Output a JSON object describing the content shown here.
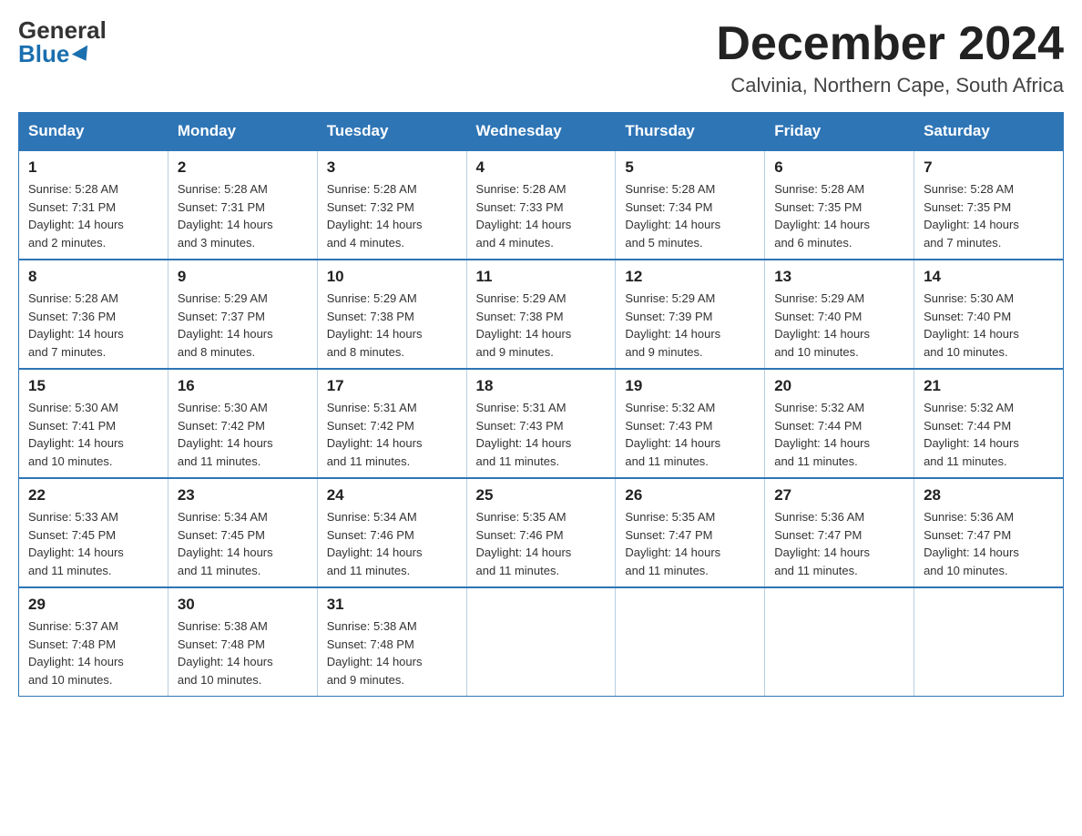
{
  "header": {
    "logo_general": "General",
    "logo_blue": "Blue",
    "month_title": "December 2024",
    "location": "Calvinia, Northern Cape, South Africa"
  },
  "calendar": {
    "days_of_week": [
      "Sunday",
      "Monday",
      "Tuesday",
      "Wednesday",
      "Thursday",
      "Friday",
      "Saturday"
    ],
    "weeks": [
      [
        {
          "day": "1",
          "sunrise": "5:28 AM",
          "sunset": "7:31 PM",
          "daylight": "14 hours and 2 minutes."
        },
        {
          "day": "2",
          "sunrise": "5:28 AM",
          "sunset": "7:31 PM",
          "daylight": "14 hours and 3 minutes."
        },
        {
          "day": "3",
          "sunrise": "5:28 AM",
          "sunset": "7:32 PM",
          "daylight": "14 hours and 4 minutes."
        },
        {
          "day": "4",
          "sunrise": "5:28 AM",
          "sunset": "7:33 PM",
          "daylight": "14 hours and 4 minutes."
        },
        {
          "day": "5",
          "sunrise": "5:28 AM",
          "sunset": "7:34 PM",
          "daylight": "14 hours and 5 minutes."
        },
        {
          "day": "6",
          "sunrise": "5:28 AM",
          "sunset": "7:35 PM",
          "daylight": "14 hours and 6 minutes."
        },
        {
          "day": "7",
          "sunrise": "5:28 AM",
          "sunset": "7:35 PM",
          "daylight": "14 hours and 7 minutes."
        }
      ],
      [
        {
          "day": "8",
          "sunrise": "5:28 AM",
          "sunset": "7:36 PM",
          "daylight": "14 hours and 7 minutes."
        },
        {
          "day": "9",
          "sunrise": "5:29 AM",
          "sunset": "7:37 PM",
          "daylight": "14 hours and 8 minutes."
        },
        {
          "day": "10",
          "sunrise": "5:29 AM",
          "sunset": "7:38 PM",
          "daylight": "14 hours and 8 minutes."
        },
        {
          "day": "11",
          "sunrise": "5:29 AM",
          "sunset": "7:38 PM",
          "daylight": "14 hours and 9 minutes."
        },
        {
          "day": "12",
          "sunrise": "5:29 AM",
          "sunset": "7:39 PM",
          "daylight": "14 hours and 9 minutes."
        },
        {
          "day": "13",
          "sunrise": "5:29 AM",
          "sunset": "7:40 PM",
          "daylight": "14 hours and 10 minutes."
        },
        {
          "day": "14",
          "sunrise": "5:30 AM",
          "sunset": "7:40 PM",
          "daylight": "14 hours and 10 minutes."
        }
      ],
      [
        {
          "day": "15",
          "sunrise": "5:30 AM",
          "sunset": "7:41 PM",
          "daylight": "14 hours and 10 minutes."
        },
        {
          "day": "16",
          "sunrise": "5:30 AM",
          "sunset": "7:42 PM",
          "daylight": "14 hours and 11 minutes."
        },
        {
          "day": "17",
          "sunrise": "5:31 AM",
          "sunset": "7:42 PM",
          "daylight": "14 hours and 11 minutes."
        },
        {
          "day": "18",
          "sunrise": "5:31 AM",
          "sunset": "7:43 PM",
          "daylight": "14 hours and 11 minutes."
        },
        {
          "day": "19",
          "sunrise": "5:32 AM",
          "sunset": "7:43 PM",
          "daylight": "14 hours and 11 minutes."
        },
        {
          "day": "20",
          "sunrise": "5:32 AM",
          "sunset": "7:44 PM",
          "daylight": "14 hours and 11 minutes."
        },
        {
          "day": "21",
          "sunrise": "5:32 AM",
          "sunset": "7:44 PM",
          "daylight": "14 hours and 11 minutes."
        }
      ],
      [
        {
          "day": "22",
          "sunrise": "5:33 AM",
          "sunset": "7:45 PM",
          "daylight": "14 hours and 11 minutes."
        },
        {
          "day": "23",
          "sunrise": "5:34 AM",
          "sunset": "7:45 PM",
          "daylight": "14 hours and 11 minutes."
        },
        {
          "day": "24",
          "sunrise": "5:34 AM",
          "sunset": "7:46 PM",
          "daylight": "14 hours and 11 minutes."
        },
        {
          "day": "25",
          "sunrise": "5:35 AM",
          "sunset": "7:46 PM",
          "daylight": "14 hours and 11 minutes."
        },
        {
          "day": "26",
          "sunrise": "5:35 AM",
          "sunset": "7:47 PM",
          "daylight": "14 hours and 11 minutes."
        },
        {
          "day": "27",
          "sunrise": "5:36 AM",
          "sunset": "7:47 PM",
          "daylight": "14 hours and 11 minutes."
        },
        {
          "day": "28",
          "sunrise": "5:36 AM",
          "sunset": "7:47 PM",
          "daylight": "14 hours and 10 minutes."
        }
      ],
      [
        {
          "day": "29",
          "sunrise": "5:37 AM",
          "sunset": "7:48 PM",
          "daylight": "14 hours and 10 minutes."
        },
        {
          "day": "30",
          "sunrise": "5:38 AM",
          "sunset": "7:48 PM",
          "daylight": "14 hours and 10 minutes."
        },
        {
          "day": "31",
          "sunrise": "5:38 AM",
          "sunset": "7:48 PM",
          "daylight": "14 hours and 9 minutes."
        },
        null,
        null,
        null,
        null
      ]
    ]
  }
}
